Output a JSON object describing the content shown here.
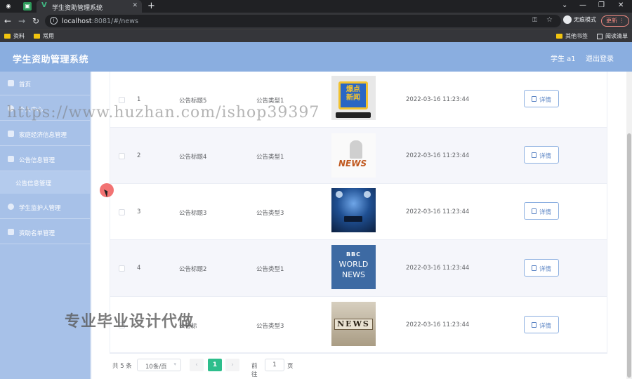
{
  "browser": {
    "tab_title": "学生资助管理系统",
    "url_host": "localhost",
    "url_rest": ":8081/#/news",
    "incognito_label": "无痕模式",
    "update_label": "更新",
    "bookmarks": [
      "资料",
      "常用",
      "其他书签",
      "阅读清单"
    ]
  },
  "app": {
    "title": "学生资助管理系统",
    "user_label": "学生 a1",
    "logout_label": "退出登录"
  },
  "sidebar": {
    "items": [
      {
        "label": "首页"
      },
      {
        "label": "个人中心"
      },
      {
        "label": "家庭经济信息管理"
      },
      {
        "label": "公告信息管理"
      },
      {
        "label": "公告信息管理"
      },
      {
        "label": "学生监护人管理"
      },
      {
        "label": "资助名单管理"
      }
    ]
  },
  "table": {
    "rows": [
      {
        "index": "1",
        "title": "公告标题5",
        "type": "公告类型1",
        "image": "news-thumb-1",
        "time": "2022-03-16 11:23:44",
        "action": "详情"
      },
      {
        "index": "2",
        "title": "公告标题4",
        "type": "公告类型1",
        "image": "news-thumb-2",
        "time": "2022-03-16 11:23:44",
        "action": "详情"
      },
      {
        "index": "3",
        "title": "公告标题3",
        "type": "公告类型3",
        "image": "news-thumb-3",
        "time": "2022-03-16 11:23:44",
        "action": "详情"
      },
      {
        "index": "4",
        "title": "公告标题2",
        "type": "公告类型1",
        "image": "news-thumb-4",
        "time": "2022-03-16 11:23:44",
        "action": "详情"
      },
      {
        "index": "",
        "title": "公告标",
        "type": "公告类型3",
        "image": "news-thumb-5",
        "time": "2022-03-16 11:23:44",
        "action": "详情"
      }
    ],
    "thumb_texts": {
      "t1": [
        "爆点",
        "新闻"
      ],
      "t2": "NEWS",
      "t4": [
        "BBC",
        "WORLD",
        "NEWS"
      ],
      "t5": "NEWS"
    }
  },
  "pager": {
    "total": "共 5 条",
    "page_size": "10条/页",
    "current_page": "1",
    "goto_label": "前往",
    "goto_value": "1",
    "page_unit": "页"
  },
  "overlay": {
    "watermark_url": "https://www.huzhan.com/ishop39397",
    "watermark_cn": "专业毕业设计代做"
  }
}
